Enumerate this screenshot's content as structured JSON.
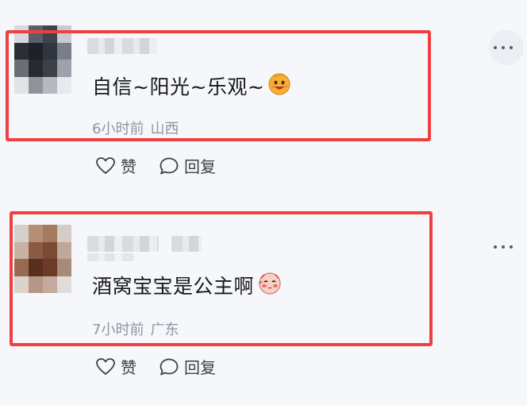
{
  "comments": [
    {
      "text": "自信~阳光~乐观~",
      "emoji_icon": "grinning-face-icon",
      "time": "6小时前",
      "location": "山西",
      "like_label": "赞",
      "reply_label": "回复",
      "avatar_icon": "avatar-pixelated"
    },
    {
      "text": "酒窝宝宝是公主啊",
      "emoji_icon": "blushing-face-icon",
      "time": "7小时前",
      "location": "广东",
      "like_label": "赞",
      "reply_label": "回复",
      "avatar_icon": "avatar-pixelated"
    }
  ],
  "colors": {
    "highlight_border": "#ee4040",
    "meta_text": "#9095a0",
    "body_text": "#16181d",
    "background": "#f6f7fb"
  }
}
